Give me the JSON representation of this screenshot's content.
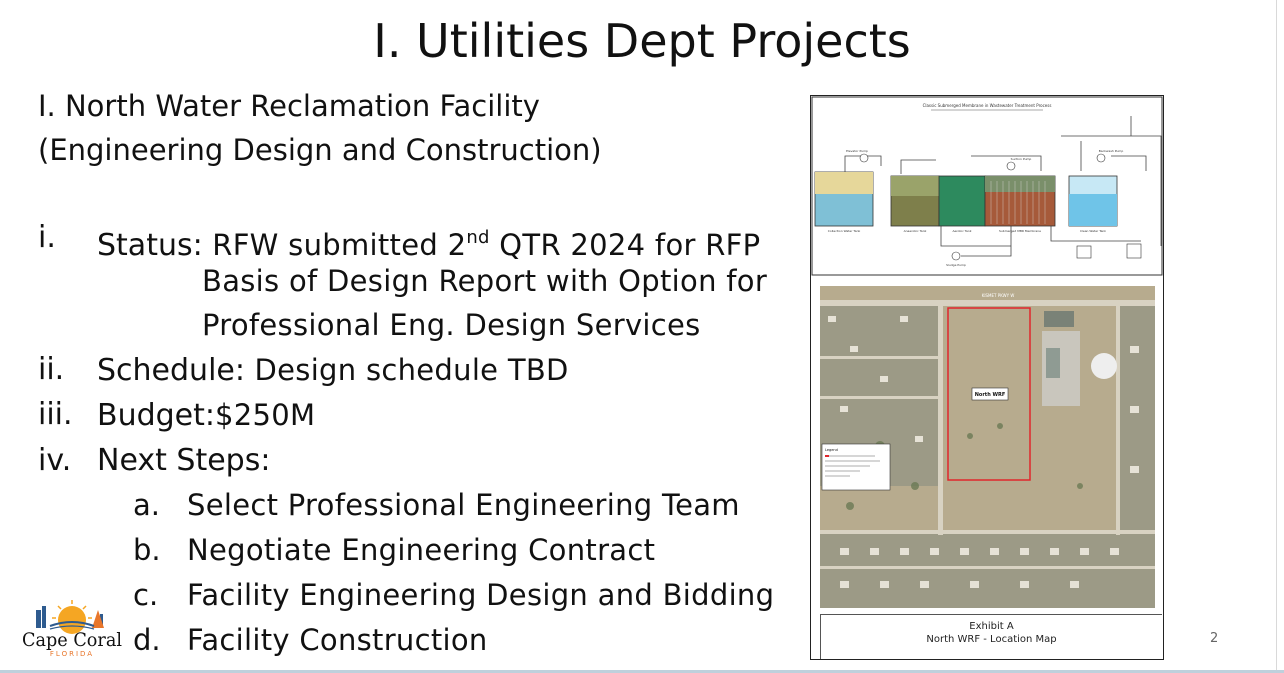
{
  "slide": {
    "title": "I. Utilities Dept Projects",
    "subtitle_line1": "I. North Water Reclamation Facility",
    "subtitle_line2": "(Engineering Design and Construction)",
    "items": [
      {
        "num": "i.",
        "label": "Status:",
        "value": "RFW submitted 2",
        "sup": "nd",
        "value_rest": " QTR 2024 for RFP",
        "cont1": "Basis of Design Report with Option for",
        "cont2": "Professional Eng. Design Services"
      },
      {
        "num": "ii.",
        "label": "Schedule:",
        "value": "Design schedule TBD"
      },
      {
        "num": "iii.",
        "label": "Budget:",
        "value": "$250M"
      },
      {
        "num": "iv.",
        "label": "Next Steps:"
      }
    ],
    "steps": [
      {
        "letter": "a.",
        "text": "Select Professional Engineering Team"
      },
      {
        "letter": "b.",
        "text": "Negotiate Engineering Contract"
      },
      {
        "letter": "c.",
        "text": "Facility Engineering Design and Bidding"
      },
      {
        "letter": "d.",
        "text": "Facility Construction"
      }
    ],
    "page_number": "2"
  },
  "exhibit": {
    "diagram_title": "Classic Submerged Membrane in Wastewater Treatment Process",
    "tank_labels": [
      "Collection Water Tank",
      "Anaerobic Tank",
      "Aerobic Tank",
      "Submerged MBR Membrane",
      "Clean Water Tank"
    ],
    "pump_labels": [
      "Elevator Pump",
      "Suction Pump",
      "Backwash Pump",
      "Sludge Pump"
    ],
    "map_street_label": "KISMET PKWY W",
    "map_site_label": "North WRF",
    "legend_title": "Legend",
    "caption_line1": "Exhibit A",
    "caption_line2": "North WRF - Location Map"
  },
  "logo": {
    "line1": "Cape Coral",
    "line2": "FLORIDA"
  },
  "colors": {
    "site_outline": "#e0262b",
    "logo_blue": "#2e5b8f",
    "logo_sun": "#f5a623",
    "logo_orange": "#e8762b"
  }
}
